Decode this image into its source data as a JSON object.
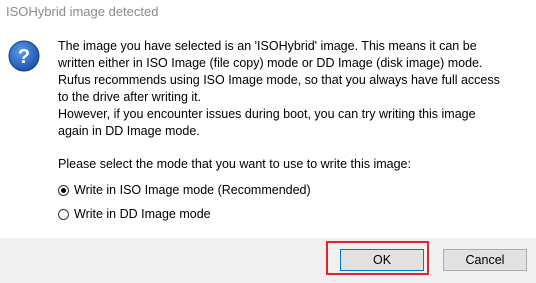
{
  "window": {
    "title": "ISOHybrid image detected"
  },
  "icons": {
    "question": "question-icon"
  },
  "message": {
    "lines": [
      "The image you have selected is an 'ISOHybrid' image. This means it can be",
      "written either in ISO Image (file copy) mode or DD Image (disk image) mode.",
      "Rufus recommends using ISO Image mode, so that you always have full access",
      "to the drive after writing it.",
      "However, if you encounter issues during boot, you can try writing this image",
      "again in DD Image mode."
    ]
  },
  "prompt": "Please select the mode that you want to use to write this image:",
  "options": [
    {
      "label": "Write in ISO Image mode (Recommended)",
      "selected": true
    },
    {
      "label": "Write in DD Image mode",
      "selected": false
    }
  ],
  "buttons": {
    "ok_label": "OK",
    "cancel_label": "Cancel"
  },
  "colors": {
    "icon_blue": "#1f5fbf",
    "highlight": "#e0282b",
    "footer_bg": "#f0f0f0"
  }
}
